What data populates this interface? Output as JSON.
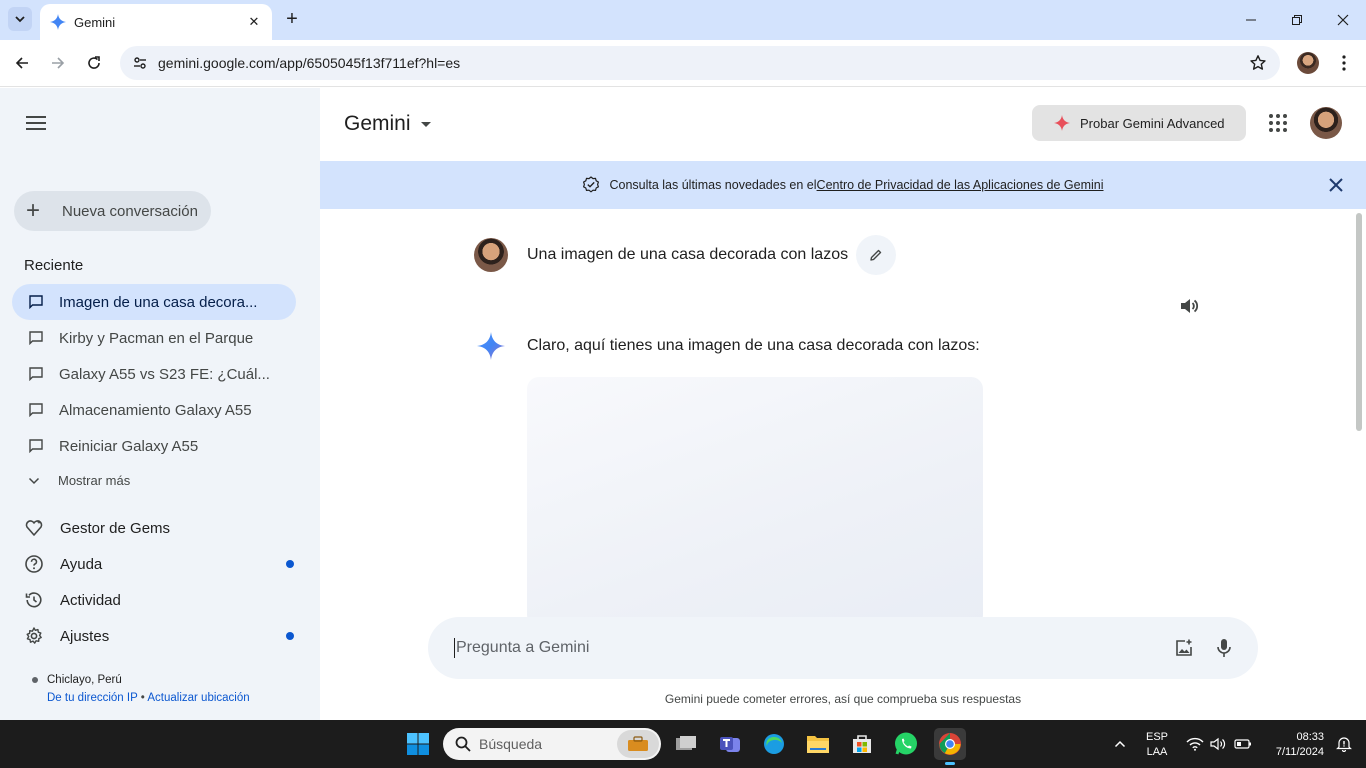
{
  "browser": {
    "tab_title": "Gemini",
    "url": "gemini.google.com/app/6505045f13f711ef?hl=es"
  },
  "sidebar": {
    "new_chat_label": "Nueva conversación",
    "recent_heading": "Reciente",
    "conversations": [
      {
        "label": "Imagen de una casa decora..."
      },
      {
        "label": "Kirby y Pacman en el Parque"
      },
      {
        "label": "Galaxy A55 vs S23 FE: ¿Cuál..."
      },
      {
        "label": "Almacenamiento Galaxy A55"
      },
      {
        "label": "Reiniciar Galaxy A55"
      }
    ],
    "show_more_label": "Mostrar más",
    "nav": [
      {
        "label": "Gestor de Gems",
        "icon": "gem-icon"
      },
      {
        "label": "Ayuda",
        "icon": "help-icon"
      },
      {
        "label": "Actividad",
        "icon": "history-icon"
      },
      {
        "label": "Ajustes",
        "icon": "settings-icon"
      }
    ],
    "location": {
      "place": "Chiclayo, Perú",
      "source": "De tu dirección IP",
      "separator": "•",
      "update": "Actualizar ubicación"
    }
  },
  "header": {
    "app_name": "Gemini",
    "advanced_button": "Probar Gemini Advanced"
  },
  "banner": {
    "text": "Consulta las últimas novedades en el ",
    "link": "Centro de Privacidad de las Aplicaciones de Gemini"
  },
  "chat": {
    "user_prompt": "Una imagen de una casa decorada con lazos",
    "response_text": "Claro, aquí tienes una imagen de una casa decorada con lazos:"
  },
  "composer": {
    "placeholder": "Pregunta a Gemini",
    "disclaimer": "Gemini puede cometer errores, así que comprueba sus respuestas"
  },
  "taskbar": {
    "search_label": "Búsqueda",
    "language": "ESP",
    "layout": "LAA",
    "time": "08:33",
    "date": "7/11/2024"
  },
  "colors": {
    "accent": "#0b57d0",
    "banner_bg": "#d3e3fd",
    "sidebar_bg": "#f0f4f9"
  }
}
